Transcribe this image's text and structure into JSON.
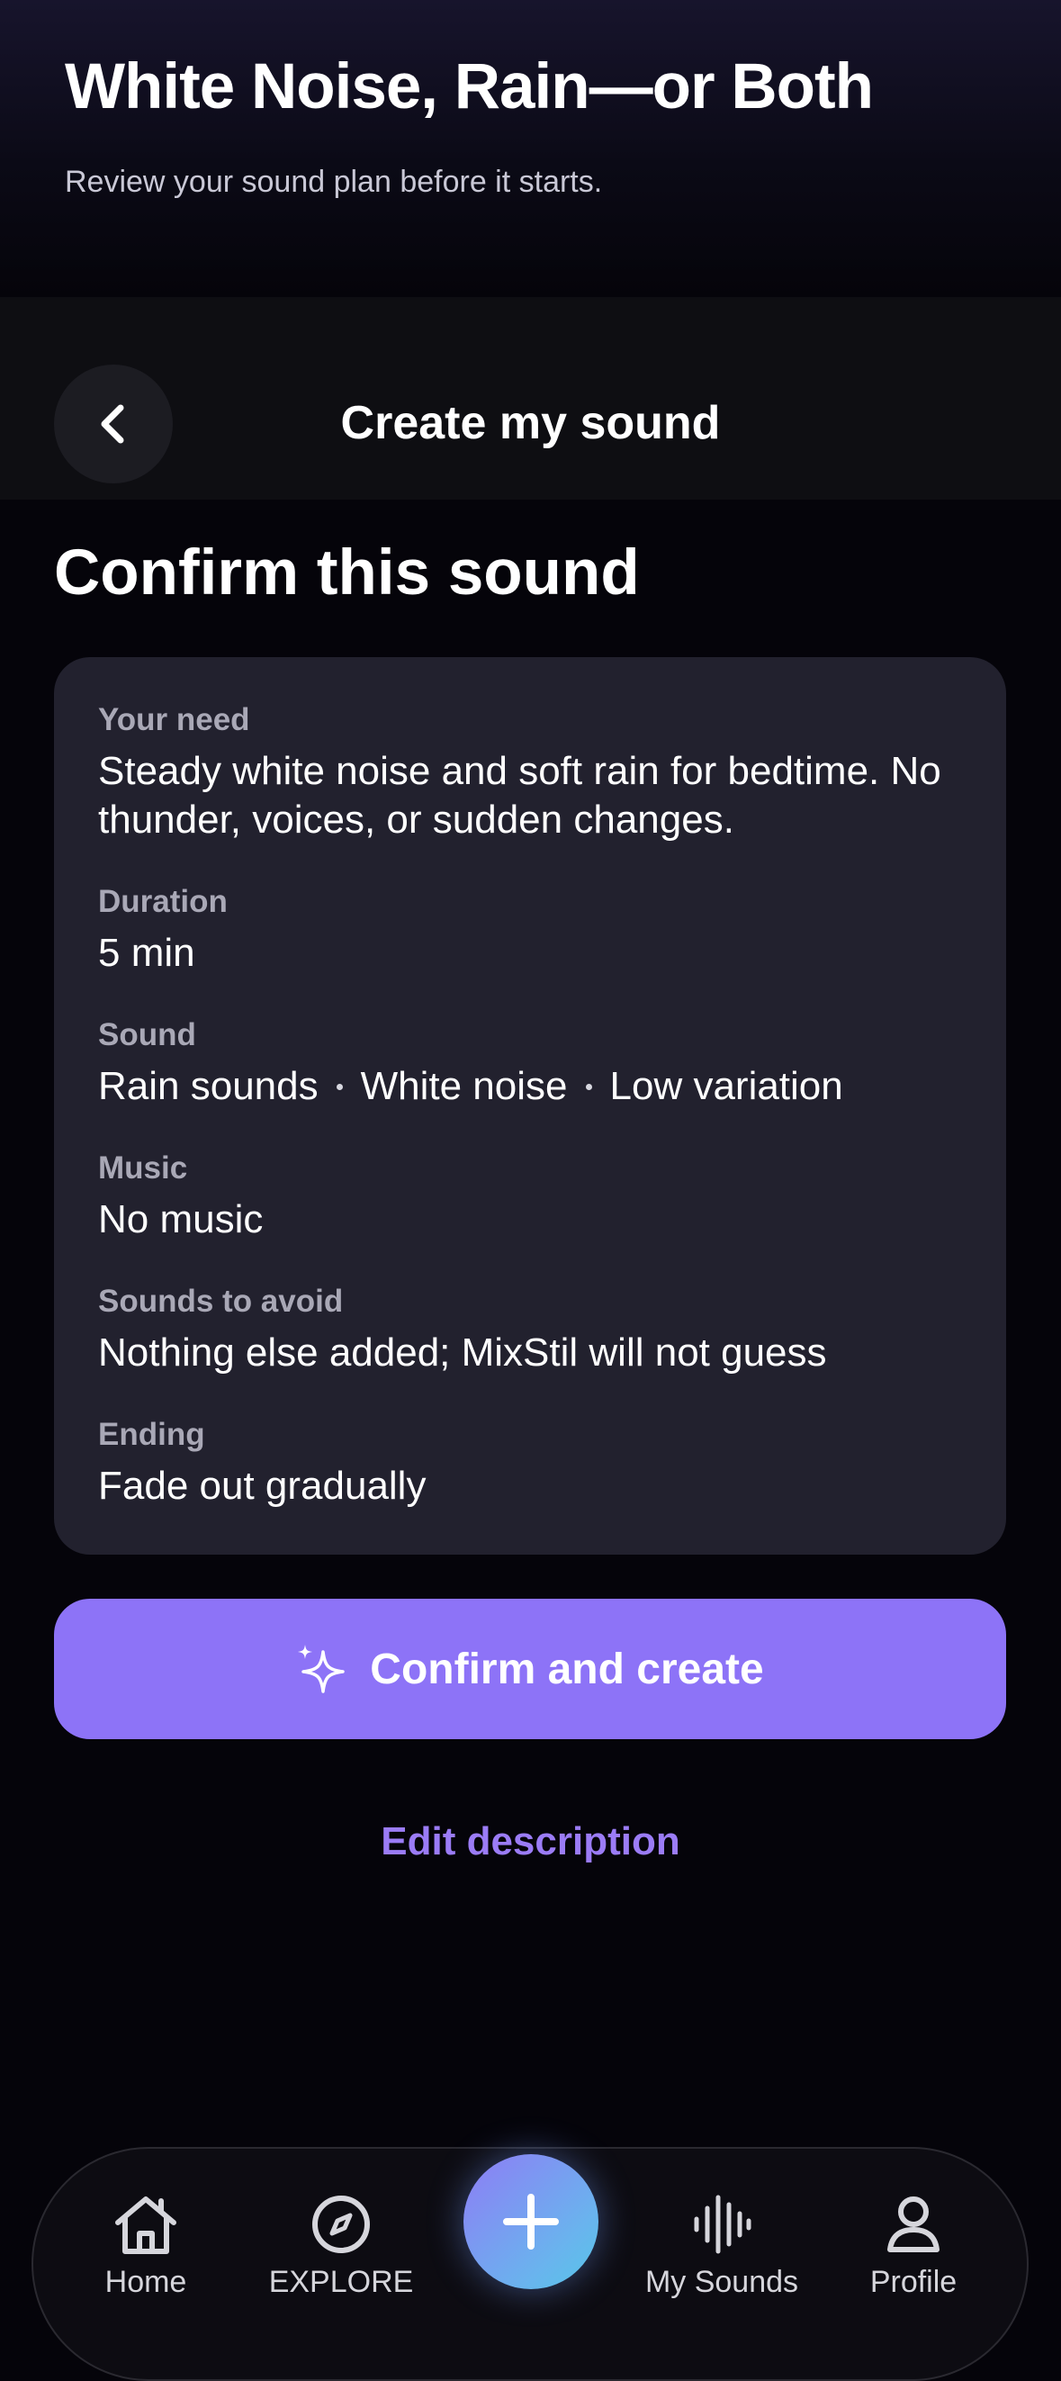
{
  "hero": {
    "title": "White Noise, Rain—or Both",
    "subtitle": "Review your sound plan before it starts."
  },
  "header": {
    "back_icon": "chevron-left-icon",
    "title": "Create my sound"
  },
  "main": {
    "section_title": "Confirm this sound",
    "fields": {
      "need": {
        "label": "Your need",
        "value": "Steady white noise and soft rain for bedtime. No thunder, voices, or sudden changes."
      },
      "duration": {
        "label": "Duration",
        "value": "5 min"
      },
      "sound": {
        "label": "Sound",
        "values": [
          "Rain sounds",
          "White noise",
          "Low variation"
        ]
      },
      "music": {
        "label": "Music",
        "value": "No music"
      },
      "avoid": {
        "label": "Sounds to avoid",
        "value": "Nothing else added; MixStil will not guess"
      },
      "ending": {
        "label": "Ending",
        "value": "Fade out gradually"
      }
    },
    "confirm_button": {
      "icon": "sparkles-icon",
      "label": "Confirm and create"
    },
    "edit_link": "Edit description"
  },
  "tabbar": {
    "items": [
      {
        "label": "Home",
        "icon": "home-icon"
      },
      {
        "label": "EXPLORE",
        "icon": "compass-icon"
      },
      {
        "label": "My Sounds",
        "icon": "waveform-icon"
      },
      {
        "label": "Profile",
        "icon": "person-icon"
      }
    ],
    "fab_icon": "plus-icon"
  },
  "colors": {
    "accent": "#8d73f7",
    "card": "#22212e",
    "background": "#05040a",
    "link": "#9b7cf6"
  }
}
